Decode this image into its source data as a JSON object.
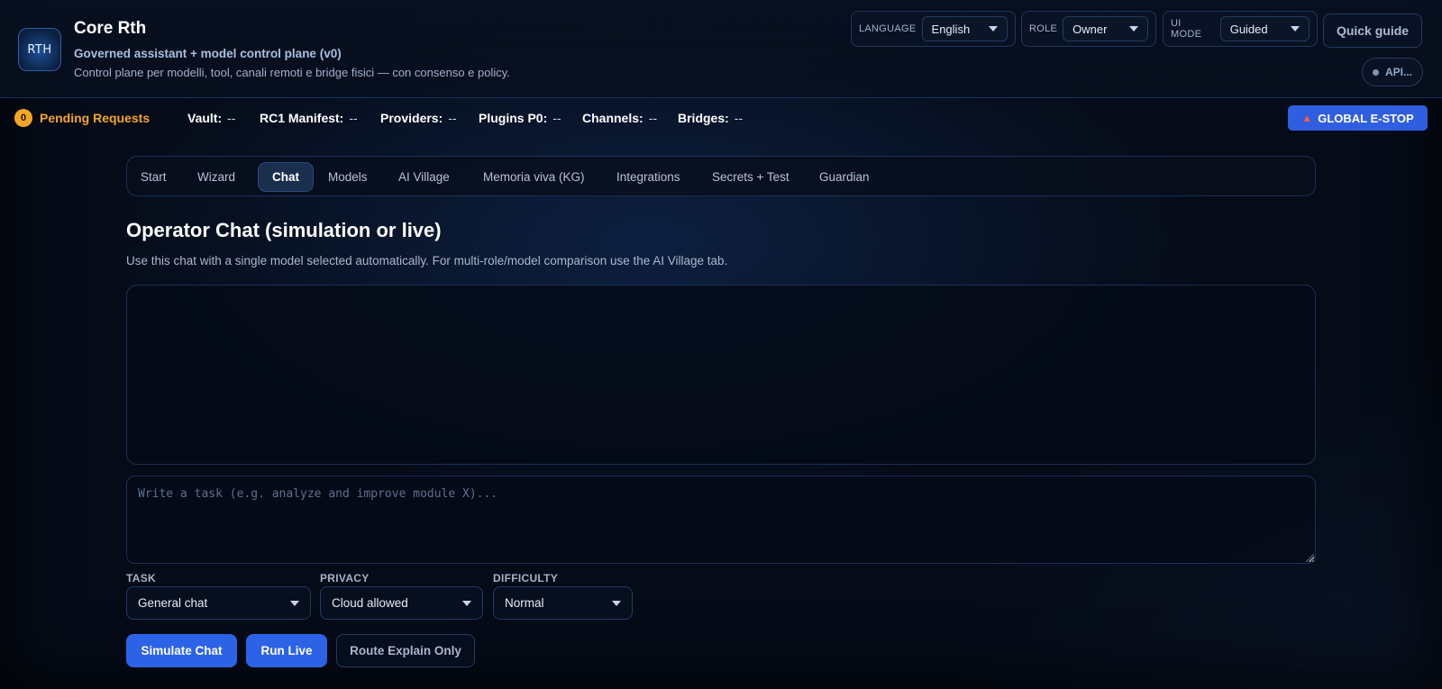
{
  "header": {
    "logo_text": "RTH",
    "title": "Core Rth",
    "subtitle": "Governed assistant + model control plane (v0)",
    "description": "Control plane per modelli, tool, canali remoti e bridge fisici — con consenso e policy.",
    "language": {
      "label": "LANGUAGE",
      "value": "English"
    },
    "role": {
      "label": "ROLE",
      "value": "Owner"
    },
    "ui_mode": {
      "label": "UI MODE",
      "value": "Guided"
    },
    "quick_guide": "Quick guide",
    "api_status": "API..."
  },
  "status": {
    "pending_count": "0",
    "pending_label": "Pending Requests",
    "items": [
      {
        "label": "Vault:",
        "value": "--"
      },
      {
        "label": "RC1 Manifest:",
        "value": "--"
      },
      {
        "label": "Providers:",
        "value": "--"
      },
      {
        "label": "Plugins P0:",
        "value": "--"
      },
      {
        "label": "Channels:",
        "value": "--"
      },
      {
        "label": "Bridges:",
        "value": "--"
      }
    ],
    "estop_label": "GLOBAL E-STOP",
    "estop_icon": "siren-icon"
  },
  "tabs": [
    {
      "label": "Start"
    },
    {
      "label": "Wizard"
    },
    {
      "label": "Chat",
      "active": true
    },
    {
      "label": "Models"
    },
    {
      "label": "AI Village"
    },
    {
      "label": "Memoria viva (KG)"
    },
    {
      "label": "Integrations"
    },
    {
      "label": "Secrets + Test"
    },
    {
      "label": "Guardian"
    }
  ],
  "main": {
    "title": "Operator Chat (simulation or live)",
    "description": "Use this chat with a single model selected automatically. For multi-role/model comparison use the AI Village tab.",
    "task_placeholder": "Write a task (e.g. analyze and improve module X)...",
    "task_field": {
      "label": "TASK",
      "value": "General chat"
    },
    "privacy_field": {
      "label": "PRIVACY",
      "value": "Cloud allowed"
    },
    "difficulty_field": {
      "label": "DIFFICULTY",
      "value": "Normal"
    },
    "buttons": {
      "simulate": "Simulate Chat",
      "run_live": "Run Live",
      "route_explain": "Route Explain Only"
    }
  },
  "colors": {
    "accent": "#2c63e6",
    "pending": "#f5a623",
    "background": "#050b17"
  }
}
